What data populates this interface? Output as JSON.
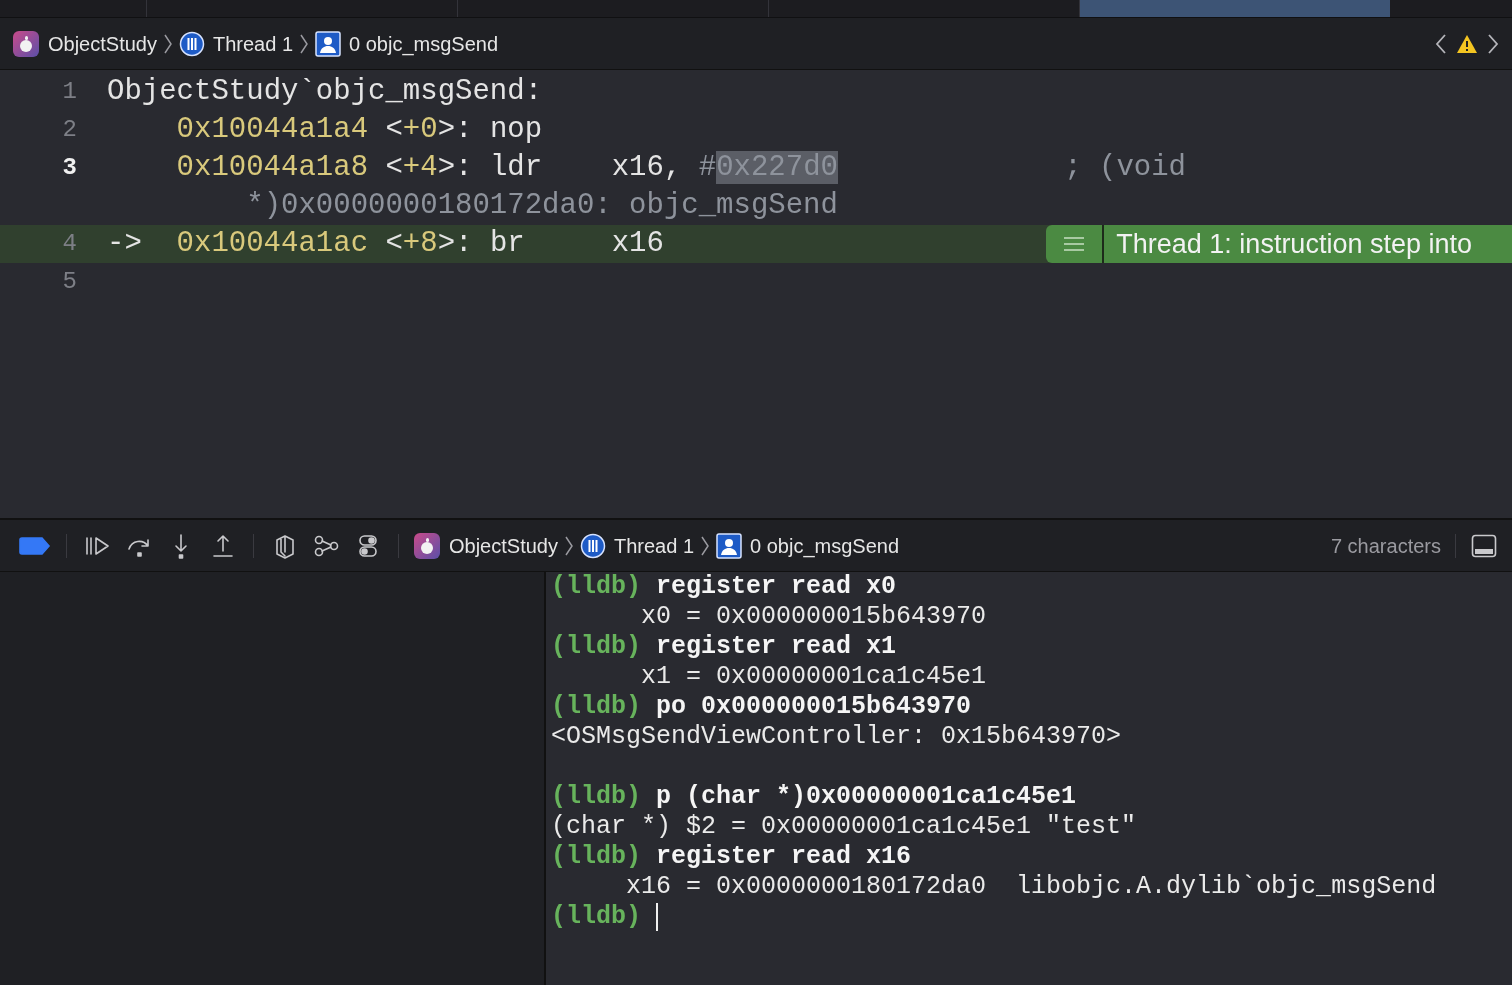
{
  "tab_strip": {
    "tabs": [
      {
        "selected": false
      },
      {
        "selected": false
      },
      {
        "selected": false
      },
      {
        "selected": true
      }
    ]
  },
  "jump_bar": {
    "path": [
      {
        "kind": "app",
        "label": "ObjectStudy"
      },
      {
        "kind": "thread",
        "label": "Thread 1"
      },
      {
        "kind": "frame",
        "label": "0 objc_msgSend"
      }
    ],
    "has_warning": true
  },
  "editor": {
    "lines": [
      {
        "number": "1",
        "cursor": false,
        "current": false,
        "segments": [
          {
            "kind": "label",
            "text": "ObjectStudy`objc_msgSend:"
          }
        ]
      },
      {
        "number": "2",
        "cursor": false,
        "current": false,
        "indented": true,
        "segments": [
          {
            "kind": "addr",
            "text": "0x10044a1a4"
          },
          {
            "kind": "plain",
            "text": " <"
          },
          {
            "kind": "addr",
            "text": "+0"
          },
          {
            "kind": "plain",
            "text": ">: nop"
          }
        ]
      },
      {
        "number": "3",
        "cursor": true,
        "current": false,
        "indented": true,
        "segments": [
          {
            "kind": "addr",
            "text": "0x10044a1a8"
          },
          {
            "kind": "plain",
            "text": " <"
          },
          {
            "kind": "addr",
            "text": "+4"
          },
          {
            "kind": "plain",
            "text": ">: ldr    x16, "
          },
          {
            "kind": "comment",
            "text": "#"
          },
          {
            "kind": "selected",
            "text": "0x227d0"
          },
          {
            "kind": "comment",
            "text": "             ; (void"
          }
        ],
        "continuation": "        *)0x0000000180172da0: objc_msgSend"
      },
      {
        "number": "4",
        "cursor": false,
        "current": true,
        "segments": [
          {
            "kind": "arrow",
            "text": "->"
          },
          {
            "kind": "addr",
            "text": "0x10044a1ac"
          },
          {
            "kind": "plain",
            "text": " <"
          },
          {
            "kind": "addr",
            "text": "+8"
          },
          {
            "kind": "plain",
            "text": ">: br     x16"
          }
        ],
        "annotation": "Thread 1: instruction step into"
      },
      {
        "number": "5",
        "cursor": false,
        "current": false
      }
    ]
  },
  "debug_bar": {
    "breakpoints_active": true,
    "path": [
      {
        "kind": "app",
        "label": "ObjectStudy"
      },
      {
        "kind": "thread",
        "label": "Thread 1"
      },
      {
        "kind": "frame",
        "label": "0 objc_msgSend"
      }
    ],
    "selection_info": "7 characters"
  },
  "console": {
    "lines": [
      {
        "kind": "prompt",
        "prompt": "(lldb)",
        "text": "register read x0"
      },
      {
        "kind": "output",
        "text": "      x0 = 0x000000015b643970"
      },
      {
        "kind": "prompt",
        "prompt": "(lldb)",
        "text": "register read x1"
      },
      {
        "kind": "output",
        "text": "      x1 = 0x00000001ca1c45e1"
      },
      {
        "kind": "prompt",
        "prompt": "(lldb)",
        "text": "po 0x000000015b643970"
      },
      {
        "kind": "output",
        "text": "<OSMsgSendViewController: 0x15b643970>"
      },
      {
        "kind": "blank"
      },
      {
        "kind": "prompt",
        "prompt": "(lldb)",
        "text": "p (char *)0x00000001ca1c45e1"
      },
      {
        "kind": "output",
        "text": "(char *) $2 = 0x00000001ca1c45e1 \"test\""
      },
      {
        "kind": "prompt",
        "prompt": "(lldb)",
        "text": "register read x16"
      },
      {
        "kind": "output",
        "text": "     x16 = 0x0000000180172da0  libobjc.A.dylib`objc_msgSend"
      },
      {
        "kind": "input",
        "prompt": "(lldb)"
      }
    ]
  }
}
